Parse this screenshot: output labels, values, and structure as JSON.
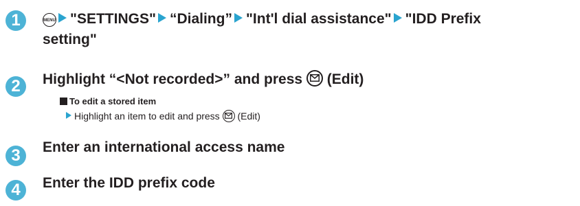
{
  "step1": {
    "number": "1",
    "menu_key": "MENU",
    "path": [
      "\"SETTINGS\"",
      "“Dialing”",
      "\"Int'l dial assistance\"",
      "\"IDD Prefix"
    ],
    "path_continuation": "setting\""
  },
  "step2": {
    "number": "2",
    "text_before": "Highlight “<Not recorded>” and press",
    "text_after": "(Edit)",
    "sub_title": "To edit a stored item",
    "sub_before": "Highlight an item to edit and press",
    "sub_after": "(Edit)"
  },
  "step3": {
    "number": "3",
    "text": "Enter an international access name"
  },
  "step4": {
    "number": "4",
    "text": "Enter the IDD prefix code"
  },
  "colors": {
    "accent": "#4db3d6",
    "arrow": "#2aa4cf",
    "text": "#231f20"
  },
  "icons": [
    "menu-key-icon",
    "mail-key-icon",
    "arrow-icon"
  ]
}
